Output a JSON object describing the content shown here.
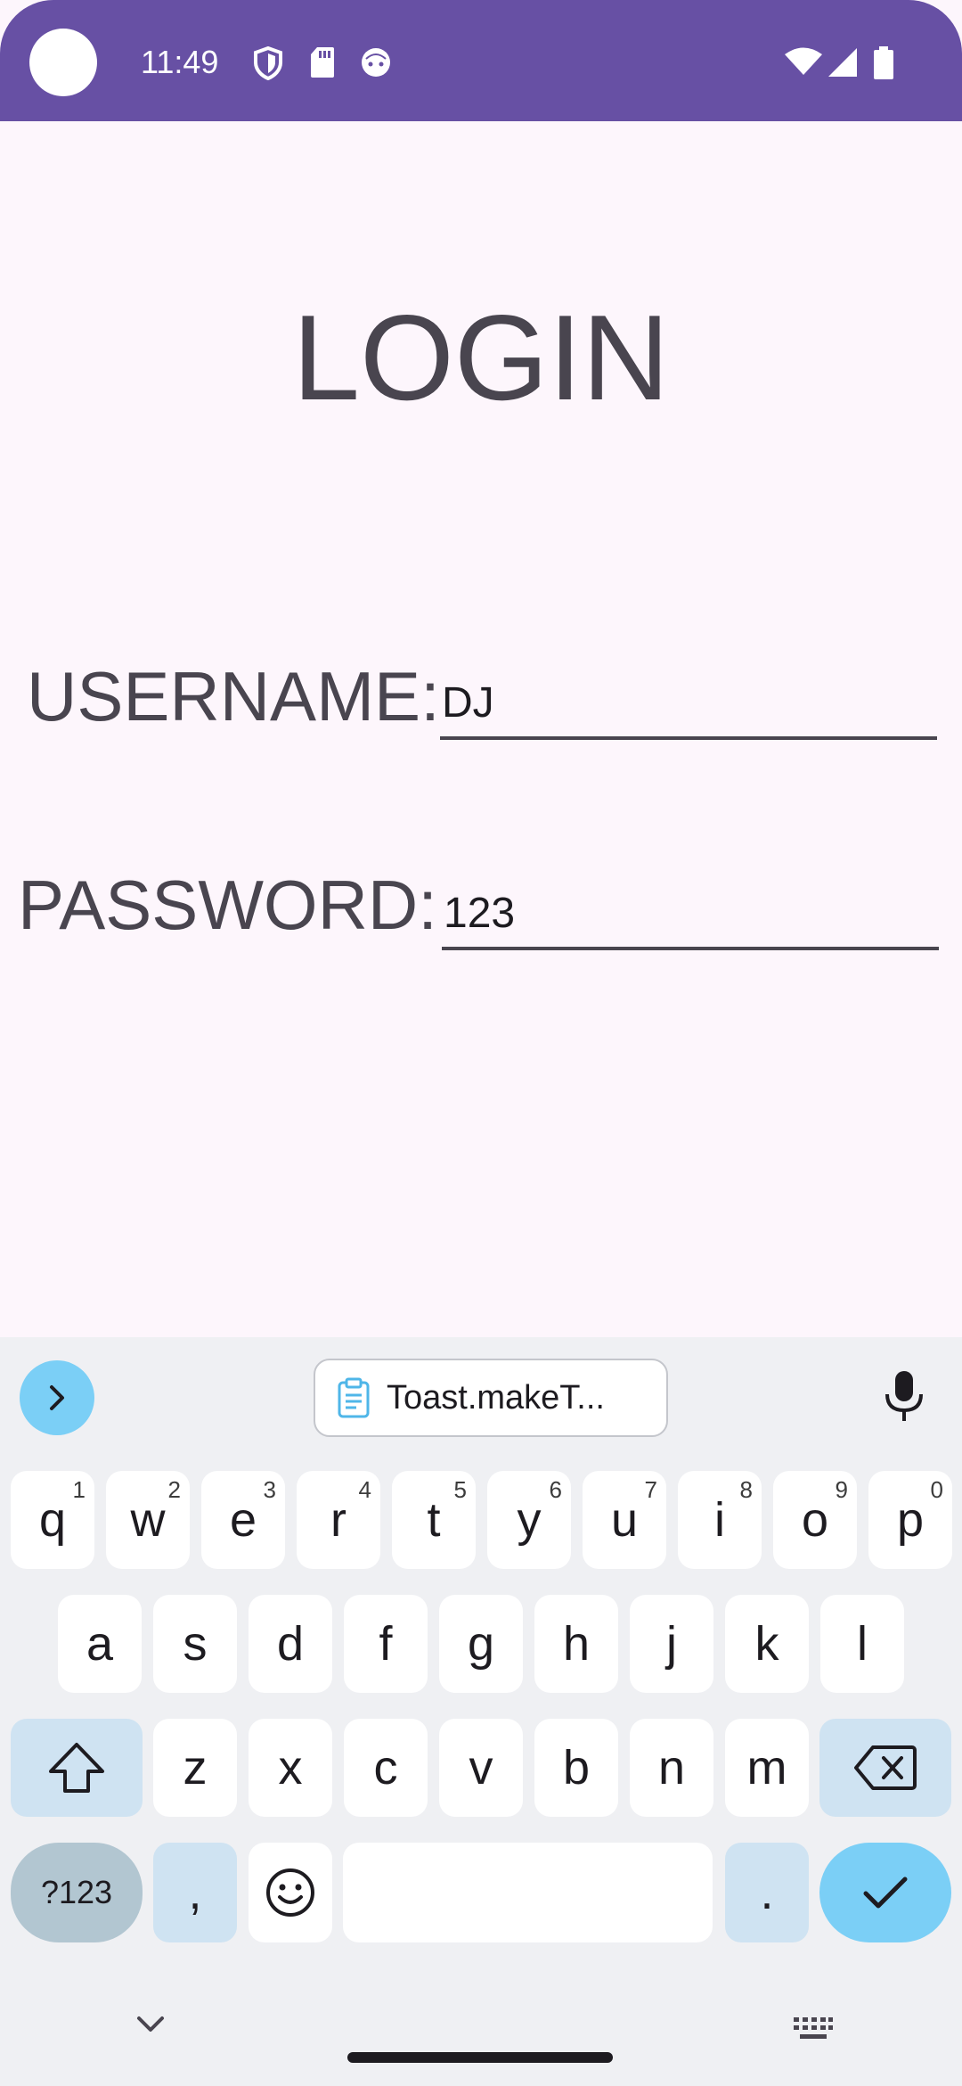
{
  "status_bar": {
    "time": "11:49",
    "left_icons": [
      "shield-icon",
      "sd-card-icon",
      "android-icon"
    ],
    "right_icons": [
      "wifi-icon",
      "signal-icon",
      "battery-icon"
    ],
    "background": "#6750a4"
  },
  "login": {
    "title": "LOGIN",
    "username_label": "USERNAME:",
    "username_value": "DJ",
    "password_label": "PASSWORD:",
    "password_value": "123"
  },
  "keyboard": {
    "clipboard_suggestion": "Toast.makeT...",
    "row1": [
      {
        "label": "q",
        "hint": "1"
      },
      {
        "label": "w",
        "hint": "2"
      },
      {
        "label": "e",
        "hint": "3"
      },
      {
        "label": "r",
        "hint": "4"
      },
      {
        "label": "t",
        "hint": "5"
      },
      {
        "label": "y",
        "hint": "6"
      },
      {
        "label": "u",
        "hint": "7"
      },
      {
        "label": "i",
        "hint": "8"
      },
      {
        "label": "o",
        "hint": "9"
      },
      {
        "label": "p",
        "hint": "0"
      }
    ],
    "row2": [
      "a",
      "s",
      "d",
      "f",
      "g",
      "h",
      "j",
      "k",
      "l"
    ],
    "row3": [
      "z",
      "x",
      "c",
      "v",
      "b",
      "n",
      "m"
    ],
    "symbols_label": "?123",
    "comma_label": ",",
    "period_label": ".",
    "accent_color": "#7bcff6"
  }
}
